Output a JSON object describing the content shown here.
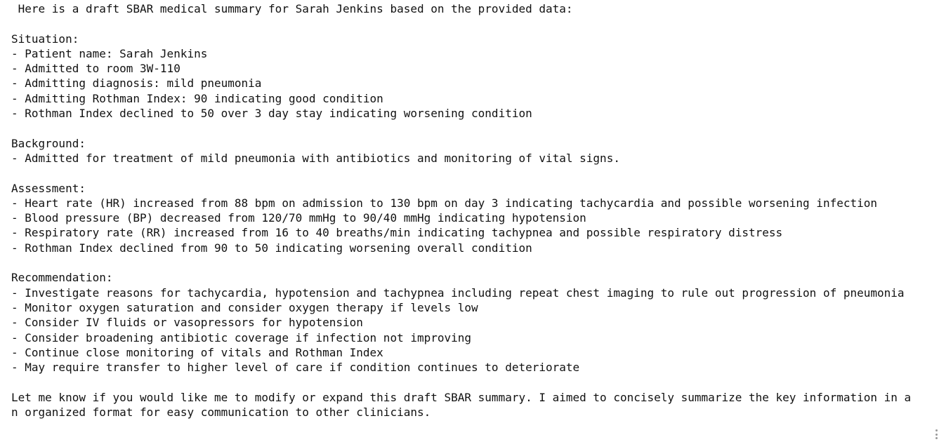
{
  "intro": " Here is a draft SBAR medical summary for Sarah Jenkins based on the provided data:",
  "situation": {
    "heading": "Situation:",
    "items": [
      "- Patient name: Sarah Jenkins",
      "- Admitted to room 3W-110",
      "- Admitting diagnosis: mild pneumonia",
      "- Admitting Rothman Index: 90 indicating good condition",
      "- Rothman Index declined to 50 over 3 day stay indicating worsening condition"
    ]
  },
  "background": {
    "heading": "Background:",
    "items": [
      "- Admitted for treatment of mild pneumonia with antibiotics and monitoring of vital signs."
    ]
  },
  "assessment": {
    "heading": "Assessment:",
    "items": [
      "- Heart rate (HR) increased from 88 bpm on admission to 130 bpm on day 3 indicating tachycardia and possible worsening infection",
      "- Blood pressure (BP) decreased from 120/70 mmHg to 90/40 mmHg indicating hypotension",
      "- Respiratory rate (RR) increased from 16 to 40 breaths/min indicating tachypnea and possible respiratory distress",
      "- Rothman Index declined from 90 to 50 indicating worsening overall condition"
    ]
  },
  "recommendation": {
    "heading": "Recommendation:",
    "items": [
      "- Investigate reasons for tachycardia, hypotension and tachypnea including repeat chest imaging to rule out progression of pneumonia",
      "- Monitor oxygen saturation and consider oxygen therapy if levels low",
      "- Consider IV fluids or vasopressors for hypotension",
      "- Consider broadening antibiotic coverage if infection not improving",
      "- Continue close monitoring of vitals and Rothman Index",
      "- May require transfer to higher level of care if condition continues to deteriorate"
    ]
  },
  "closing": [
    "Let me know if you would like me to modify or expand this draft SBAR summary. I aimed to concisely summarize the key information in a",
    "n organized format for easy communication to other clinicians."
  ]
}
